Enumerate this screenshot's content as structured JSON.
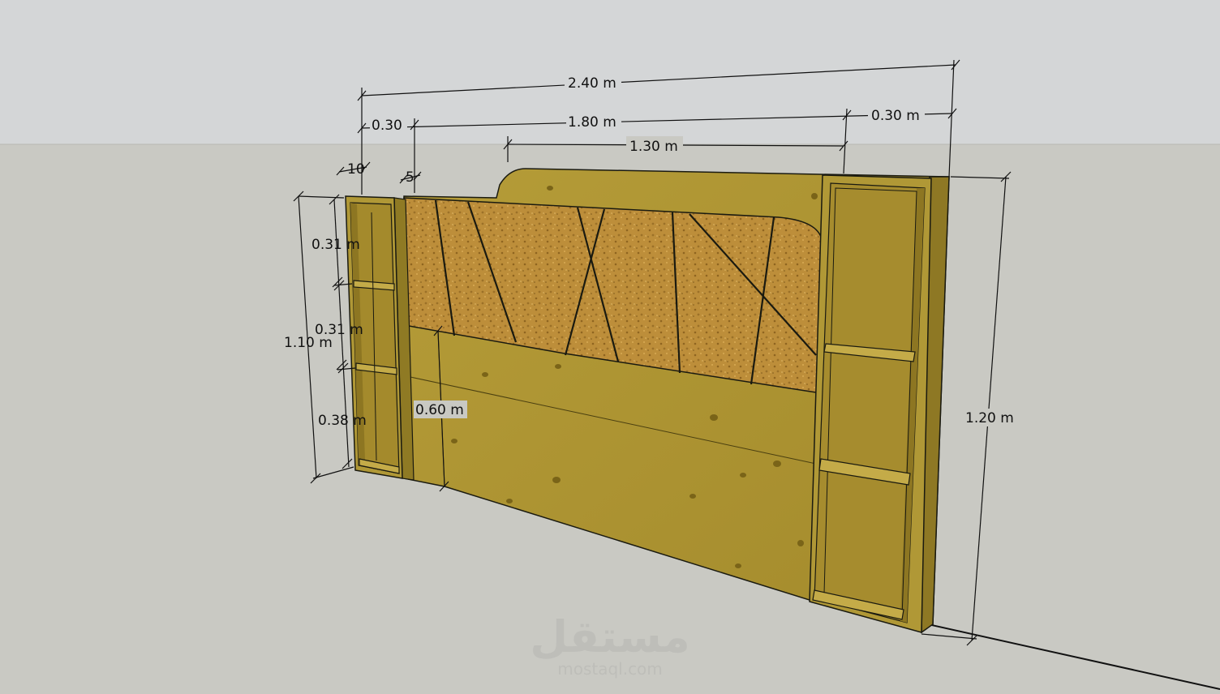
{
  "colors": {
    "sky": "#d4d6d7",
    "ground": "#c9c9c3",
    "wood": "#a88e2e",
    "wood_light": "#b39a36",
    "wood_dark": "#7d6a1c",
    "cork": "#bd8e3a",
    "edge": "#1a1a10"
  },
  "dimensions": {
    "total_width": "2.40 m",
    "left_unit_width": "0.30",
    "center_width": "1.80 m",
    "right_unit_width": "0.30 m",
    "panel_width": "1.30 m",
    "side_depth": "10",
    "panel_offset": "5",
    "shelf_top": "0.31 m",
    "shelf_mid": "0.31 m",
    "shelf_bottom": "0.38 m",
    "side_height": "1.10 m",
    "base_height": "0.60 m",
    "total_height": "1.20 m"
  },
  "watermark": {
    "arabic": "مستقل",
    "site": "mostaql.com"
  }
}
